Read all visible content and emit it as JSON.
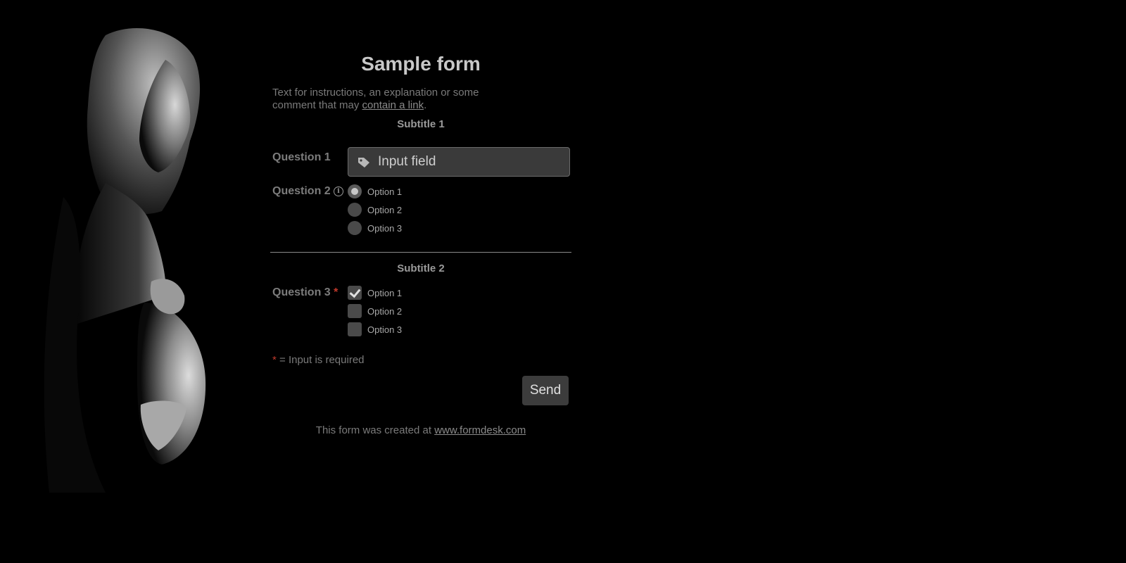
{
  "form": {
    "title": "Sample form",
    "intro_text": "Text for instructions, an explanation or some comment that may ",
    "intro_link": "contain a link",
    "intro_end": ".",
    "subtitle_1": "Subtitle 1",
    "subtitle_2": "Subtitle 2",
    "question_1": {
      "label": "Question 1",
      "placeholder": "Input field",
      "icon": "tag-icon"
    },
    "question_2": {
      "label": "Question 2",
      "info_icon": "info-icon",
      "options": [
        "Option 1",
        "Option 2",
        "Option 3"
      ],
      "selected": "Option 1"
    },
    "question_3": {
      "label": "Question 3",
      "required_mark": "*",
      "options": [
        "Option 1",
        "Option 2",
        "Option 3"
      ],
      "checked": [
        "Option 1"
      ]
    },
    "required_note": {
      "mark": "*",
      "text": " = Input is required"
    },
    "send_label": "Send",
    "footer_text": "This form was created at ",
    "footer_link": "www.formdesk.com"
  },
  "colors": {
    "background": "#000000",
    "required": "#c0392b",
    "title": "#c8c8c8"
  }
}
